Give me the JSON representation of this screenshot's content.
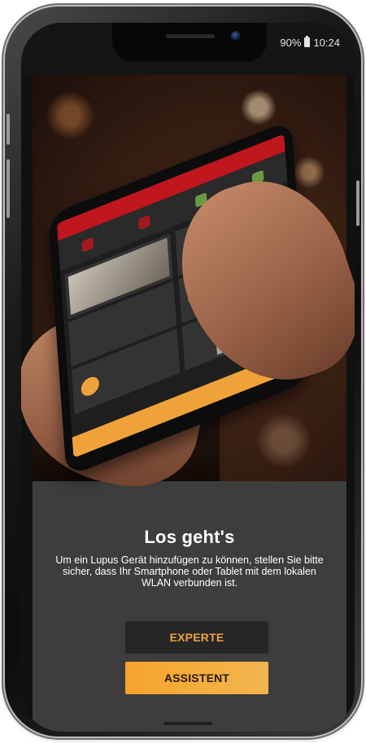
{
  "status_bar": {
    "battery": "90%",
    "time": "10:24"
  },
  "onboarding": {
    "title": "Los geht's",
    "description": "Um ein Lupus Gerät hinzufügen zu können, stellen Sie bitte sicher, dass Ihr Smartphone oder Tablet mit dem lokalen WLAN verbunden ist.",
    "buttons": {
      "expert": "EXPERTE",
      "assistant": "ASSISTENT"
    }
  },
  "colors": {
    "accent": "#f0a23a",
    "background": "#3d3d3d",
    "expert_button": "#262626"
  },
  "icons": {
    "battery": "battery-icon",
    "camera": "camera-icon"
  }
}
